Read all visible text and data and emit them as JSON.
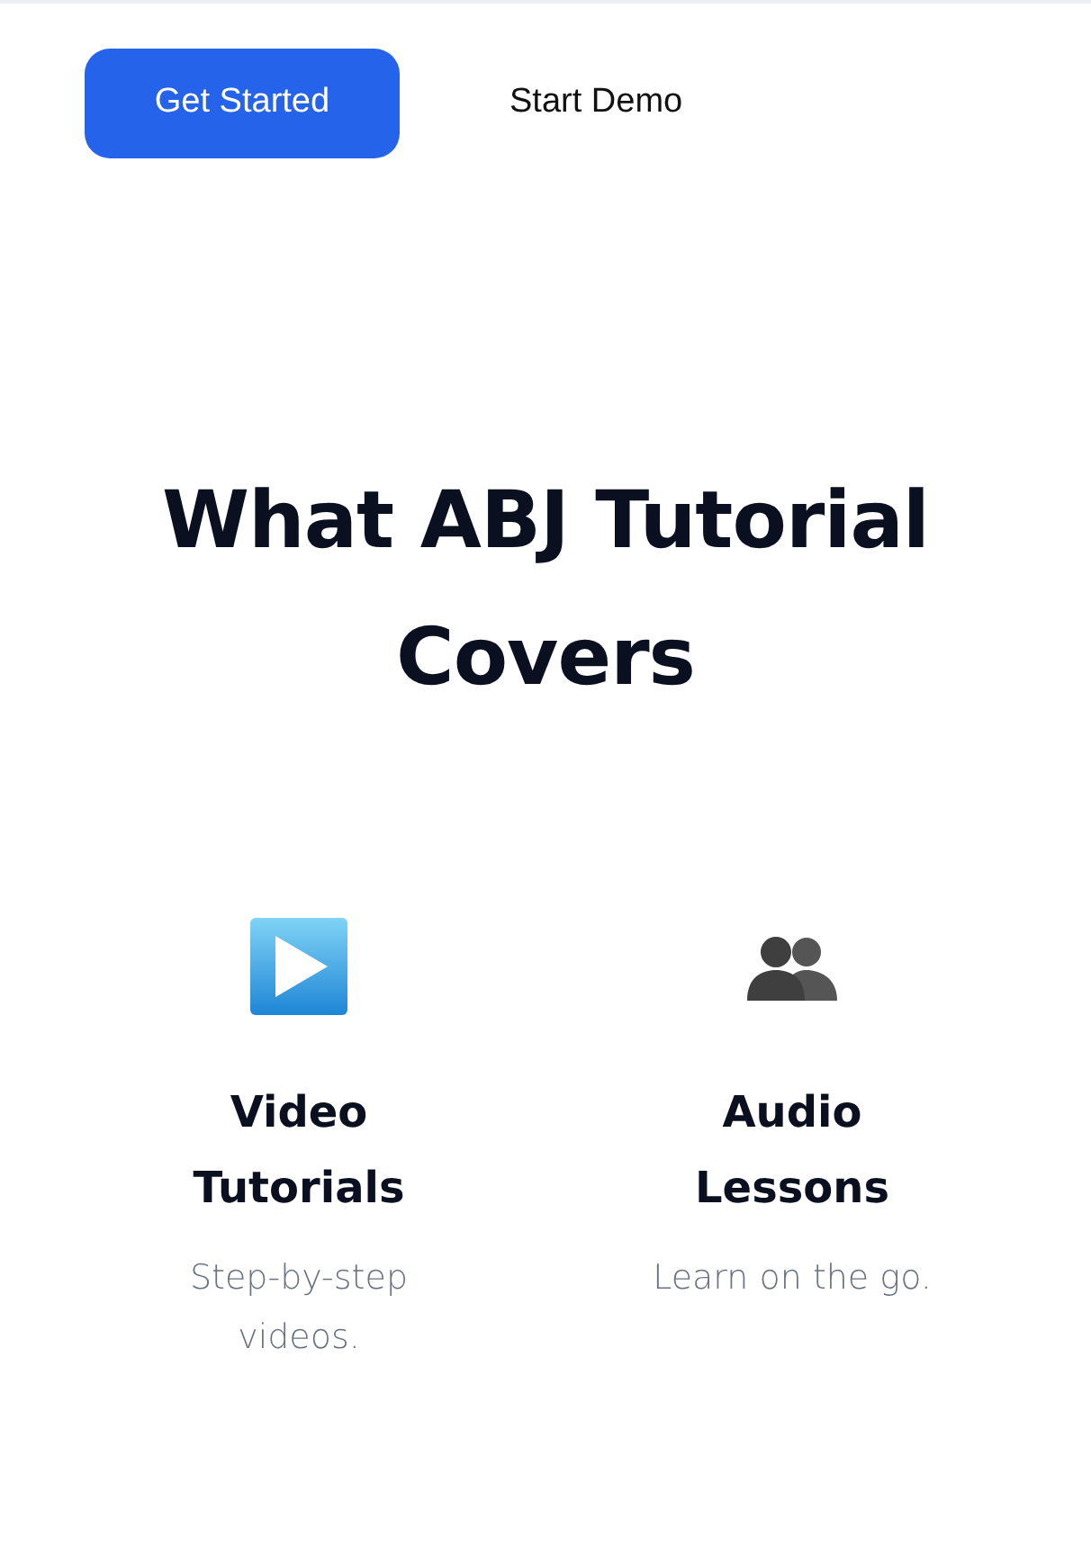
{
  "actions": [
    {
      "label": "Get Started",
      "kind": "primary"
    },
    {
      "label": "Start Demo",
      "kind": "plain"
    }
  ],
  "section": {
    "title": "What ABJ Tutorial Covers"
  },
  "features": [
    {
      "kind": "video",
      "title": "Video Tutorials",
      "description": "Step-by-step videos."
    },
    {
      "kind": "audio",
      "title": "Audio Lessons",
      "description": "Learn on the go."
    }
  ]
}
